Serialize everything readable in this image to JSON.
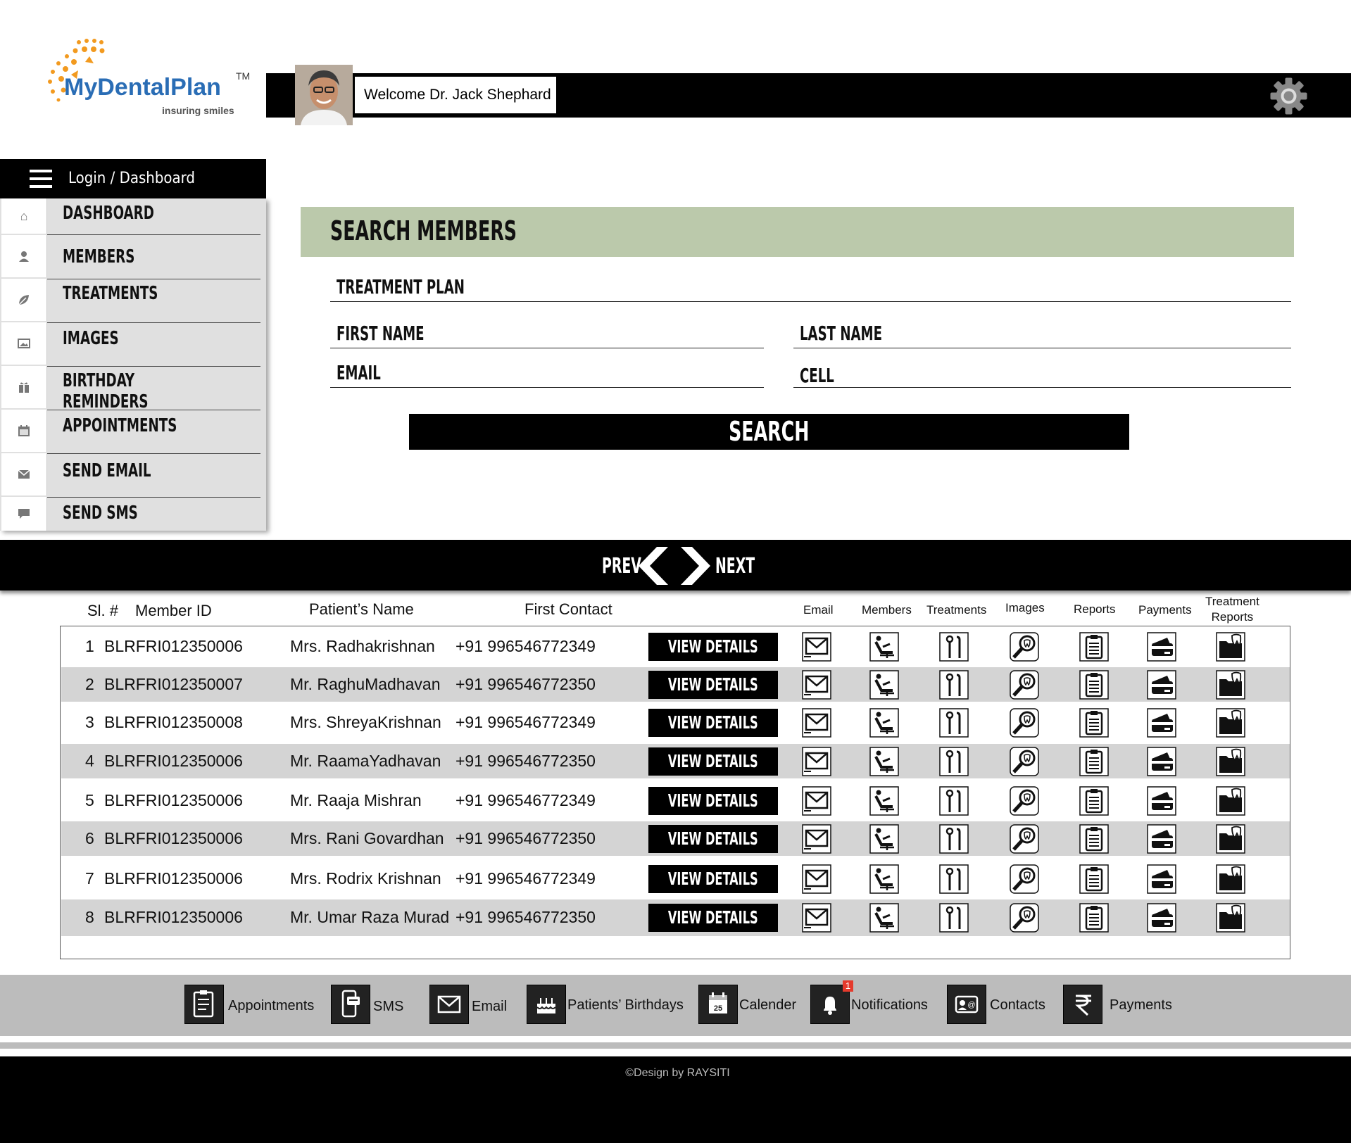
{
  "brand": {
    "name_part1": "MyDental",
    "name_part2": "Plan",
    "tm": "TM",
    "tagline": "insuring smiles",
    "orange": "#f29a1f",
    "blue": "#2a6db5"
  },
  "header": {
    "welcome": "Welcome Dr. Jack Shephard",
    "settings_icon": "gear-icon"
  },
  "sidebar": {
    "header_label": "Login / Dashboard",
    "items": [
      {
        "label": "DASHBOARD",
        "icon": "home-icon"
      },
      {
        "label": "MEMBERS",
        "icon": "user-icon"
      },
      {
        "label": "TREATMENTS",
        "icon": "leaf-icon"
      },
      {
        "label": "IMAGES",
        "icon": "image-icon"
      },
      {
        "label": "BIRTHDAY REMINDERS",
        "icon": "gift-icon"
      },
      {
        "label": "APPOINTMENTS",
        "icon": "calendar-icon"
      },
      {
        "label": "SEND EMAIL",
        "icon": "envelope-icon"
      },
      {
        "label": "SEND SMS",
        "icon": "chat-icon"
      }
    ]
  },
  "search": {
    "title": "SEARCH MEMBERS",
    "treatment_plan": "TREATMENT PLAN",
    "first_name": "FIRST NAME",
    "last_name": "LAST NAME",
    "email": "EMAIL",
    "cell": "CELL",
    "button": "SEARCH",
    "header_color": "#bbc9ab"
  },
  "pager": {
    "prev": "PREV",
    "next": "NEXT"
  },
  "table": {
    "headers": {
      "sl": "Sl. #",
      "member_id": "Member ID",
      "name": "Patient’s Name",
      "contact": "First Contact",
      "email": "Email",
      "members": "Members",
      "treatments": "Treatments",
      "images": "Images",
      "reports": "Reports",
      "payments": "Payments",
      "treatment_reports_1": "Treatment",
      "treatment_reports_2": "Reports"
    },
    "view_label": "VIEW DETAILS",
    "rows": [
      {
        "sl": "1",
        "id": "BLRFRI012350006",
        "name": "Mrs. Radhakrishnan",
        "contact": "+91 996546772349"
      },
      {
        "sl": "2",
        "id": "BLRFRI012350007",
        "name": "Mr. RaghuMadhavan",
        "contact": "+91 996546772350"
      },
      {
        "sl": "3",
        "id": "BLRFRI012350008",
        "name": "Mrs. ShreyaKrishnan",
        "contact": "+91 996546772349"
      },
      {
        "sl": "4",
        "id": "BLRFRI012350006",
        "name": "Mr. RaamaYadhavan",
        "contact": "+91 996546772350"
      },
      {
        "sl": "5",
        "id": "BLRFRI012350006",
        "name": "Mr. Raaja   Mishran",
        "contact": "+91 996546772349"
      },
      {
        "sl": "6",
        "id": "BLRFRI012350006",
        "name": "Mrs. Rani Govardhan",
        "contact": "+91 996546772350"
      },
      {
        "sl": "7",
        "id": "BLRFRI012350006",
        "name": "Mrs. Rodrix Krishnan",
        "contact": "+91 996546772349"
      },
      {
        "sl": "8",
        "id": "BLRFRI012350006",
        "name": "Mr. Umar Raza Murad",
        "contact": "+91 996546772350"
      }
    ],
    "row_icons": [
      "email-icon",
      "dental-chair-icon",
      "dental-tools-icon",
      "tooth-search-icon",
      "clipboard-icon",
      "card-payment-icon",
      "folder-tooth-icon"
    ]
  },
  "bottom_bar": {
    "items": [
      {
        "label": "Appointments",
        "icon": "appointments-icon"
      },
      {
        "label": "SMS",
        "icon": "sms-icon"
      },
      {
        "label": "Email",
        "icon": "mail-icon"
      },
      {
        "label": "Patients’ Birthdays",
        "icon": "cake-icon"
      },
      {
        "label": "Calender",
        "icon": "calendar-icon"
      },
      {
        "label": "Notifications",
        "icon": "bell-icon"
      },
      {
        "label": "Contacts",
        "icon": "contact-card-icon"
      },
      {
        "label": "Payments",
        "icon": "rupee-icon"
      }
    ],
    "notification_count": "1"
  },
  "footer": {
    "copyright": "©Design by RAYSITI"
  }
}
